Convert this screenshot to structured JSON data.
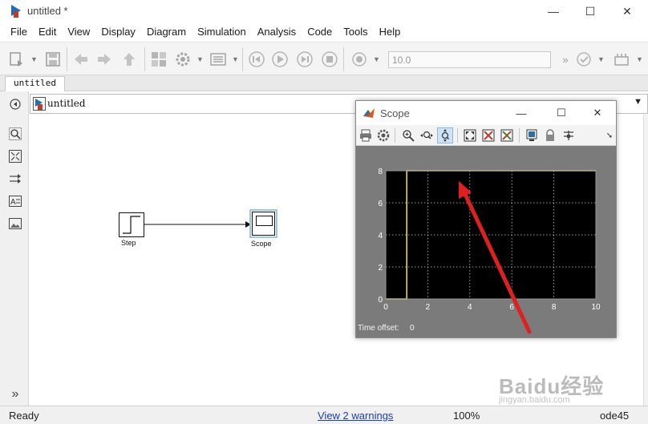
{
  "window": {
    "title": "untitled *",
    "minimize_glyph": "—",
    "maximize_glyph": "☐",
    "close_glyph": "✕"
  },
  "menu": [
    "File",
    "Edit",
    "View",
    "Display",
    "Diagram",
    "Simulation",
    "Analysis",
    "Code",
    "Tools",
    "Help"
  ],
  "toolbar": {
    "stop_time": "10.0",
    "icons": [
      "new-model-icon",
      "save-icon",
      "back-icon",
      "forward-icon",
      "up-icon",
      "library-browser-icon",
      "model-settings-icon",
      "model-explorer-icon",
      "step-back-icon",
      "run-icon",
      "step-forward-icon",
      "stop-icon",
      "record-icon",
      "more-icon",
      "check-icon",
      "build-icon"
    ]
  },
  "tab": {
    "label": "untitled"
  },
  "explorer": {
    "path": "untitled"
  },
  "palette": {
    "icons": [
      "hide-show-browser-icon",
      "zoom-icon",
      "fit-to-view-icon",
      "route-arrow-icon",
      "annotation-icon",
      "image-icon",
      "expand-icon"
    ],
    "expand_glyph": "»"
  },
  "blocks": {
    "step": {
      "label": "Step"
    },
    "scope": {
      "label": "Scope"
    }
  },
  "scope_window": {
    "title": "Scope",
    "time_offset_label": "Time offset:",
    "time_offset_value": "0",
    "toolbar_icons": [
      "print-icon",
      "parameters-icon",
      "zoom-in-icon",
      "zoom-x-icon",
      "zoom-y-icon",
      "autoscale-icon",
      "save-axes-icon",
      "restore-axes-icon",
      "floating-scope-icon",
      "lock-axes-icon",
      "signal-selection-icon"
    ]
  },
  "chart_data": {
    "type": "line",
    "title": "",
    "xlabel": "",
    "ylabel": "",
    "xlim": [
      0,
      10
    ],
    "ylim": [
      0,
      8
    ],
    "x_ticks": [
      "0",
      "2",
      "4",
      "6",
      "8",
      "10"
    ],
    "y_ticks": [
      "0",
      "2",
      "4",
      "6",
      "8"
    ],
    "grid": true,
    "background": "#000000",
    "line_color": "#f5e06a",
    "series": [
      {
        "x": [
          0,
          1,
          1,
          10
        ],
        "y": [
          0,
          0,
          8,
          8
        ]
      }
    ]
  },
  "annotation": {
    "color": "#e02020"
  },
  "status": {
    "ready": "Ready",
    "warnings": "View 2 warnings",
    "zoom": "100%",
    "solver": "ode45"
  },
  "watermark": {
    "text": "Baidu经验",
    "sub": "jingyan.baidu.com"
  }
}
